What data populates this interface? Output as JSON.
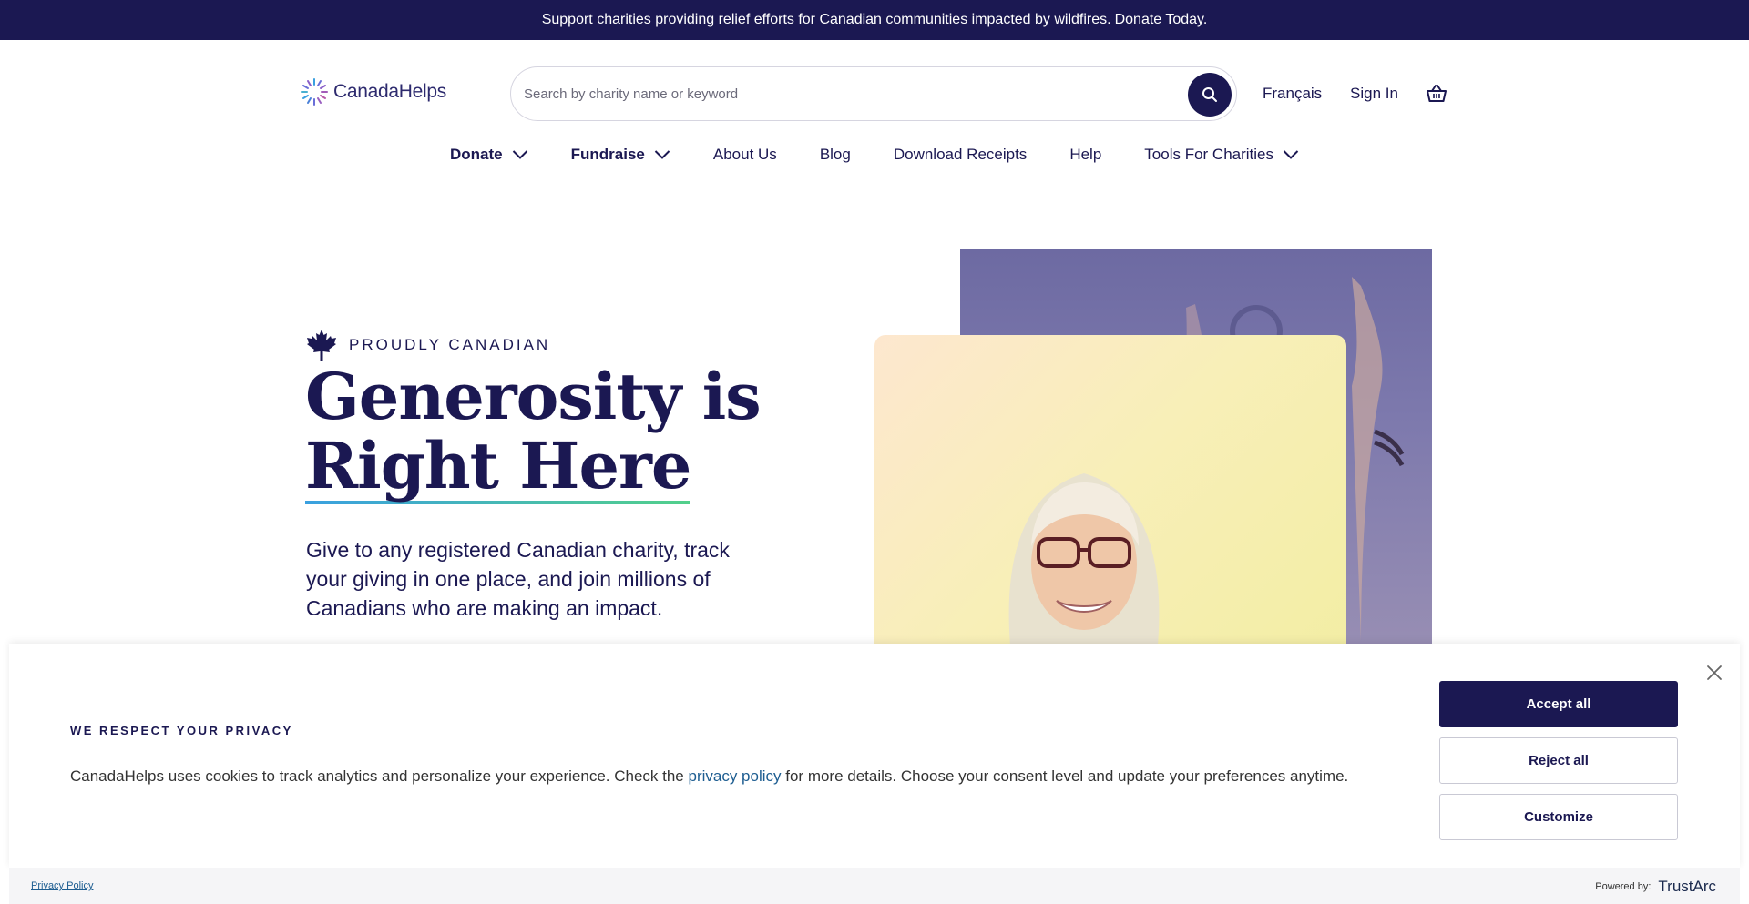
{
  "announcement": {
    "text": "Support charities providing relief efforts for Canadian communities impacted by wildfires.",
    "link": "Donate Today."
  },
  "header": {
    "logo_text": "CanadaHelps",
    "search_placeholder": "Search by charity name or keyword",
    "language": "Français",
    "sign_in": "Sign In"
  },
  "nav": {
    "items": [
      {
        "label": "Donate"
      },
      {
        "label": "Fundraise"
      },
      {
        "label": "About Us"
      },
      {
        "label": "Blog"
      },
      {
        "label": "Download Receipts"
      },
      {
        "label": "Help"
      },
      {
        "label": "Tools For Charities"
      }
    ]
  },
  "hero": {
    "eyebrow": "PROUDLY CANADIAN",
    "headline_line1": "Generosity is",
    "headline_line2": "Right Here",
    "description": "Give to any registered Canadian charity, track your giving in one place, and join millions of Canadians who are making an impact."
  },
  "cookie": {
    "title": "WE RESPECT YOUR PRIVACY",
    "text_before": "CanadaHelps uses cookies to track analytics and personalize your experience. Check the ",
    "link": "privacy policy",
    "text_after": " for more details. Choose your consent level and update your preferences anytime.",
    "accept": "Accept all",
    "reject": "Reject all",
    "customize": "Customize"
  },
  "footer": {
    "privacy_link": "Privacy Policy",
    "powered_by": "Powered by:",
    "brand": "TrustArc"
  },
  "colors": {
    "brand_navy": "#1b1852",
    "link_blue": "#1d5d91",
    "underline_start": "#3aa0e0",
    "underline_end": "#52d08a"
  }
}
